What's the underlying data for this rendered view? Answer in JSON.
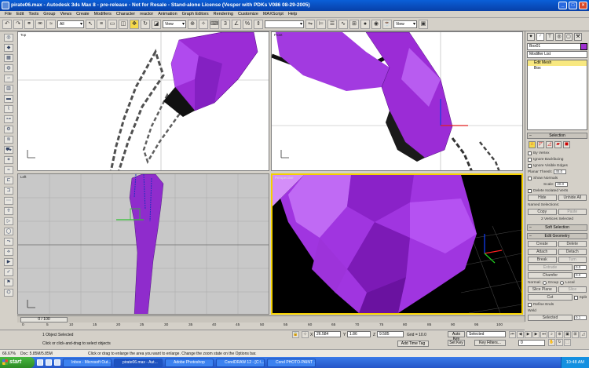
{
  "window": {
    "title": "pirate06.max - Autodesk 3ds Max 8 - pre-release - Not for Resale - Stand-alone License (Vesper with PDKs V086 08-29-2005)"
  },
  "menu": [
    "File",
    "Edit",
    "Tools",
    "Group",
    "Views",
    "Create",
    "Modifiers",
    "Character",
    "reactor",
    "Animation",
    "Graph Editors",
    "Rendering",
    "Customize",
    "MAXScript",
    "Help"
  ],
  "toolbar": {
    "selection_filter": "All",
    "ref_coord": "View",
    "ref_coord2": "View",
    "named_sel": ""
  },
  "viewports": {
    "top": "Top",
    "front": "Front",
    "left": "Left",
    "perspective": "Perspective"
  },
  "panel": {
    "object_name": "Box01",
    "modifier_list": "Modifier List",
    "stack": [
      "Edit Mesh",
      "Box"
    ],
    "selection_title": "Selection",
    "by_vertex": "By Vertex",
    "ignore_backfacing": "Ignore Backfacing",
    "ignore_visible_edges": "Ignore Visible Edges",
    "planar_thresh_label": "Planar Thresh:",
    "planar_thresh": "45.0",
    "show_normals": "Show Normals",
    "scale_label": "Scale:",
    "scale": "20.0",
    "delete_isolated": "Delete Isolated Verts",
    "hide": "Hide",
    "unhide_all": "Unhide All",
    "named_selections": "Named Selections:",
    "copy": "Copy",
    "paste": "Paste",
    "sel_status": "2 Vertices Selected",
    "soft_selection": "Soft Selection",
    "edit_geometry": "Edit Geometry",
    "create": "Create",
    "delete": "Delete",
    "attach": "Attach",
    "detach": "Detach",
    "break": "Break",
    "turn": "Turn",
    "extrude": "Extrude",
    "extrude_val": "0.0",
    "chamfer": "Chamfer",
    "chamfer_val": "0.0",
    "normal": "Normal:",
    "group": "Group",
    "local": "Local",
    "slice_plane": "Slice Plane",
    "slice": "Slice",
    "cut": "Cut",
    "split": "Split",
    "refine_ends": "Refine Ends",
    "weld": "Weld",
    "selected": "Selected",
    "selected_val": "0.1"
  },
  "timeline": {
    "frame": "0 / 100",
    "ticks": [
      "0",
      "5",
      "10",
      "15",
      "20",
      "25",
      "30",
      "35",
      "40",
      "45",
      "50",
      "55",
      "60",
      "65",
      "70",
      "75",
      "80",
      "85",
      "90",
      "95",
      "100"
    ]
  },
  "status": {
    "objects": "1 Object Selected",
    "prompt": "Click or click-and-drag to select objects",
    "lower_prompt": "Click or drag to enlarge the area you want to enlarge. Change the zoom state on the Options bar.",
    "x": "26.584",
    "y": "1.86",
    "z": "9.585",
    "grid": "Grid = 10.0",
    "add_time_tag": "Add Time Tag",
    "auto_key": "Auto Key",
    "set_key": "Set Key",
    "key_sel": "Selected",
    "key_filters": "Key Filters...",
    "frame_field": "0",
    "left_num": "66.67%",
    "doc": "Doc: 5.85M/5.85M"
  },
  "taskbar": {
    "start": "start",
    "tasks": [
      "Inbox - Microsoft Out...",
      "pirate06.max - Aut...",
      "Adobe Photoshop",
      "CorelDRAW 12 - [C:\\...",
      "Corel PHOTO-PAINT ..."
    ],
    "clock": "10:48 AM"
  }
}
